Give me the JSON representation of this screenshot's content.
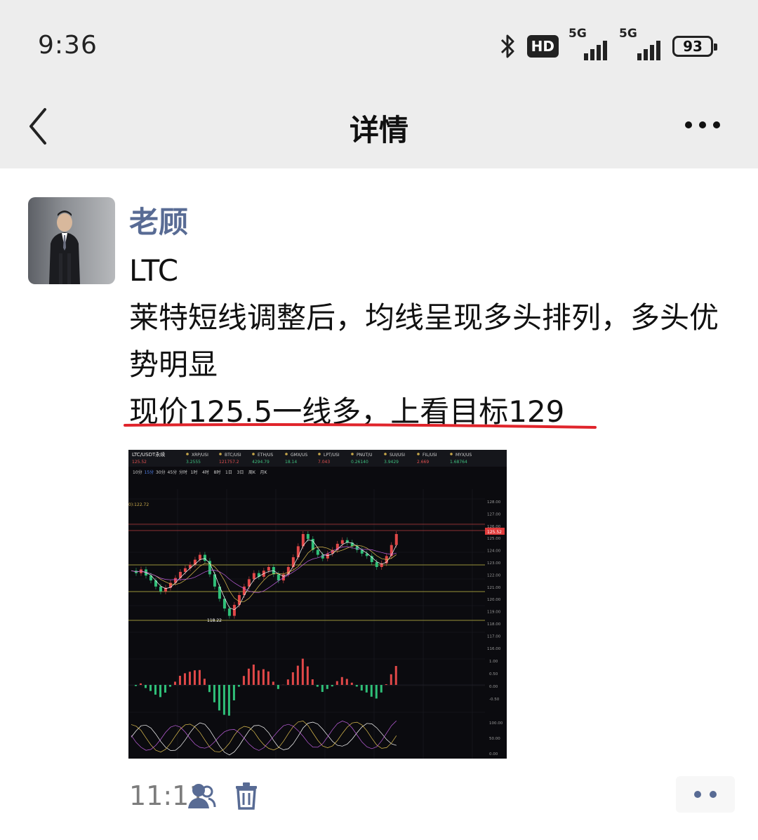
{
  "status_bar": {
    "time": "9:36",
    "hd_label": "HD",
    "network1": "5G",
    "network2": "5G",
    "battery": "93"
  },
  "nav": {
    "title": "详情"
  },
  "post": {
    "author": "老顾",
    "lines": [
      "LTC",
      "莱特短线调整后，均线呈现多头排列，多头优势明显",
      "现价125.5一线多，上看目标129"
    ],
    "time": "11:11"
  },
  "chart_image": {
    "pair": "LTC/USDT永续",
    "price": "125.52",
    "tickers": [
      "XRP/USI",
      "BTC/USI",
      "ETH/US",
      "GMX/US",
      "LPT/USI",
      "PNUT/U",
      "SUI/USI",
      "FIL/USI",
      "MYX/US"
    ],
    "ticker_values": [
      "3.2555",
      "121757.2",
      "4294.79",
      "18.14",
      "7.043",
      "0.26140",
      "3.9429",
      "2.669",
      "1.68764"
    ],
    "timeframes": [
      "10分",
      "15分",
      "30分",
      "45分",
      "分时",
      "1时",
      "4时",
      "8时",
      "1日",
      "3日",
      "周K",
      "月K"
    ],
    "low_label": "118.22",
    "ma_label": "0):122.72",
    "right_axis": [
      "128.00",
      "127.00",
      "126.00",
      "125.00",
      "124.00",
      "123.00",
      "122.00",
      "121.00",
      "120.00",
      "119.00",
      "118.00",
      "117.00",
      "116.00"
    ],
    "macd_axis": [
      "1.00",
      "0.50",
      "0.00",
      "-0.50"
    ],
    "kdj_axis": [
      "100.00",
      "50.00",
      "0.00"
    ],
    "candles": [
      122.3,
      122.1,
      122.4,
      121.9,
      121.5,
      121.0,
      120.6,
      120.9,
      121.3,
      121.7,
      122.2,
      122.5,
      122.8,
      123.2,
      123.6,
      123.1,
      122.0,
      121.0,
      120.0,
      119.2,
      118.6,
      119.5,
      120.3,
      121.0,
      121.6,
      122.1,
      121.8,
      122.3,
      122.6,
      122.0,
      121.5,
      122.0,
      122.6,
      123.4,
      124.3,
      125.3,
      124.9,
      124.0,
      123.6,
      123.3,
      123.7,
      124.0,
      124.5,
      124.8,
      124.6,
      124.3,
      124.0,
      123.7,
      123.5,
      123.0,
      122.6,
      122.9,
      123.5,
      124.4,
      125.3
    ]
  }
}
